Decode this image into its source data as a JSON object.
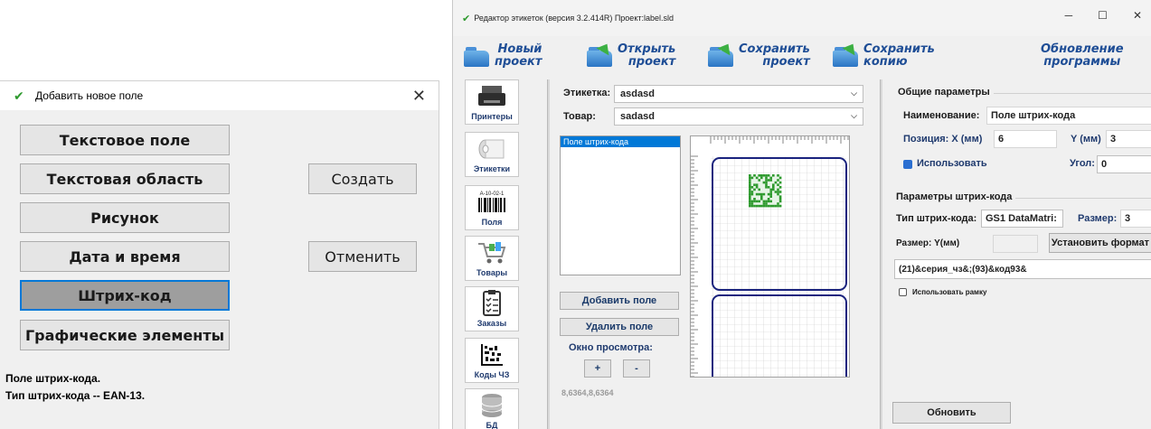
{
  "dialog": {
    "title": "Добавить новое поле",
    "buttons": [
      "Текстовое поле",
      "Текстовая область",
      "Рисунок",
      "Дата и время",
      "Штрих-код",
      "Графические элементы"
    ],
    "create_label": "Создать",
    "cancel_label": "Отменить",
    "info_line1": "Поле штрих-кода.",
    "info_line2": "Тип штрих-кода -- EAN-13."
  },
  "window": {
    "title": "Редактор этикеток (версия 3.2.414R) Проект:label.sld",
    "toolbar": {
      "new": [
        "Новый",
        "проект"
      ],
      "open": [
        "Открыть",
        "проект"
      ],
      "save": [
        "Сохранить",
        "проект"
      ],
      "save_copy": [
        "Сохранить",
        "копию"
      ],
      "update": [
        "Обновление",
        "программы"
      ]
    },
    "sidebar": [
      "Принтеры",
      "Этикетки",
      "Поля",
      "Товары",
      "Заказы",
      "Коды ЧЗ",
      "БД"
    ],
    "barcode_sample_text": "A-10-02-1",
    "label_field": {
      "label": "Этикетка:",
      "value": "asdasd"
    },
    "product_field": {
      "label": "Товар:",
      "value": "sadasd"
    },
    "fields_list": [
      "Поле штрих-кода"
    ],
    "add_field": "Добавить поле",
    "remove_field": "Удалить поле",
    "preview_label": "Окно просмотра:",
    "zoom_in": "+",
    "zoom_out": "-",
    "coords": "8,6364,8,6364"
  },
  "params": {
    "general_title": "Общие параметры",
    "name_label": "Наименование:",
    "name_value": "Поле штрих-кода",
    "pos_label": "Позиция:  X (мм)",
    "x_value": "6",
    "y_label": "Y (мм)",
    "y_value": "3",
    "use_label": "Использовать",
    "angle_label": "Угол:",
    "angle_value": "0",
    "barcode_title": "Параметры штрих-кода",
    "type_label": "Тип штрих-кода:",
    "type_value": "GS1 DataMatri:",
    "size_label": "Размер:",
    "size_value": "3",
    "size_y_label": "Размер: Y(мм)",
    "set_format": "Установить формат",
    "format_value": "(21)&серия_чз&;(93)&код93&",
    "use_frame": "Использовать рамку",
    "refresh": "Обновить"
  },
  "colors": {
    "accent": "#0078d7",
    "toolbar_text": "#1f4e96",
    "datamatrix": "#2e9a2e",
    "label_border": "#1a237e"
  }
}
